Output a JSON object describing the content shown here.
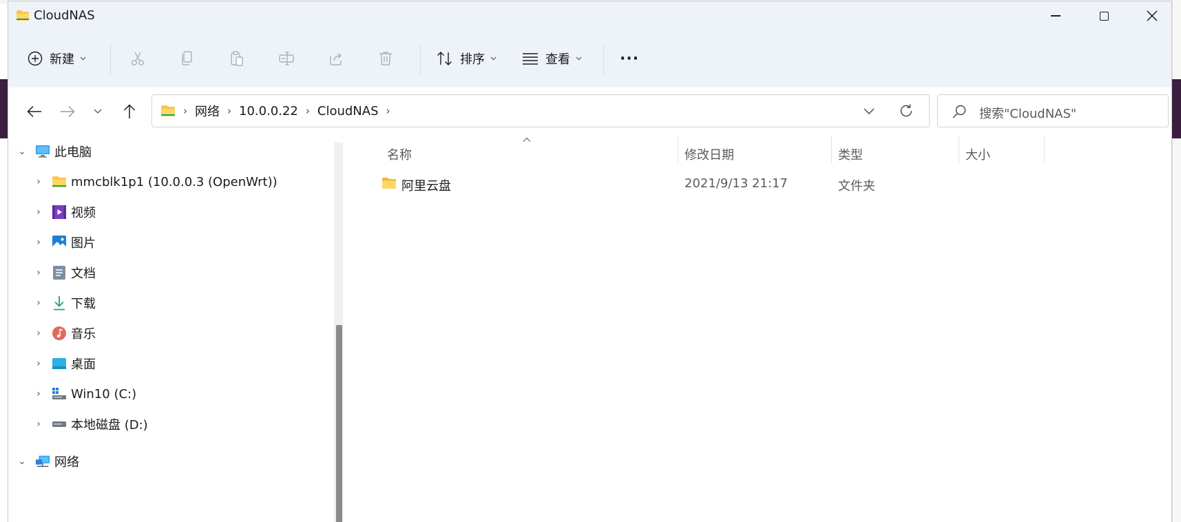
{
  "window": {
    "title": "CloudNAS"
  },
  "toolbar": {
    "new_label": "新建",
    "sort_label": "排序",
    "view_label": "查看",
    "more_label": "···"
  },
  "address": {
    "crumbs": [
      "网络",
      "10.0.0.22",
      "CloudNAS"
    ]
  },
  "search": {
    "placeholder": "搜索\"CloudNAS\""
  },
  "nav": {
    "items": [
      {
        "label": "此电脑",
        "icon": "pc-icon",
        "expanded": true
      },
      {
        "label": "mmcblk1p1 (10.0.0.3 (OpenWrt))",
        "icon": "folder-icon"
      },
      {
        "label": "视频",
        "icon": "video-icon"
      },
      {
        "label": "图片",
        "icon": "pictures-icon"
      },
      {
        "label": "文档",
        "icon": "documents-icon"
      },
      {
        "label": "下载",
        "icon": "download-icon"
      },
      {
        "label": "音乐",
        "icon": "music-icon"
      },
      {
        "label": "桌面",
        "icon": "desktop-icon"
      },
      {
        "label": "Win10 (C:)",
        "icon": "system-drive-icon"
      },
      {
        "label": "本地磁盘 (D:)",
        "icon": "drive-icon"
      },
      {
        "label": "网络",
        "icon": "network-icon",
        "expanded": true
      }
    ]
  },
  "columns": {
    "name": "名称",
    "modified": "修改日期",
    "type": "类型",
    "size": "大小"
  },
  "files": [
    {
      "name": "阿里云盘",
      "modified": "2021/9/13 21:17",
      "type": "文件夹",
      "size": ""
    }
  ],
  "colors": {
    "accent": "#0067c0",
    "folder": "#f8c74a",
    "toolbar_bg": "#eef3f9"
  }
}
